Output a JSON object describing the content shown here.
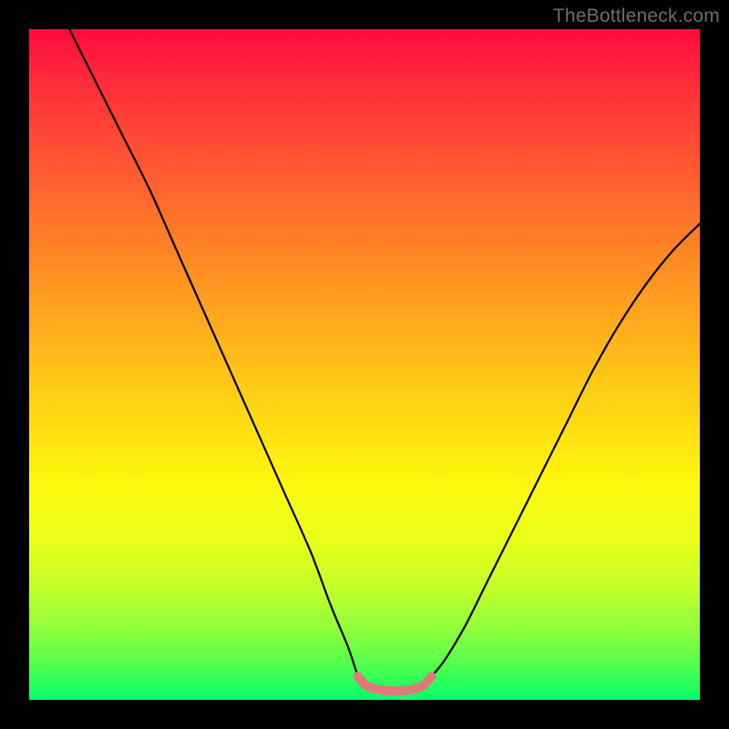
{
  "watermark": "TheBottleneck.com",
  "chart_data": {
    "type": "line",
    "title": "",
    "xlabel": "",
    "ylabel": "",
    "xlim": [
      0,
      100
    ],
    "ylim": [
      0,
      100
    ],
    "grid": false,
    "legend": false,
    "background_gradient": {
      "orientation": "vertical",
      "stops": [
        {
          "pos": 0,
          "color": "#ff0a3c"
        },
        {
          "pos": 18,
          "color": "#ff4f33"
        },
        {
          "pos": 42,
          "color": "#ffa41e"
        },
        {
          "pos": 67,
          "color": "#fff60d"
        },
        {
          "pos": 89,
          "color": "#94ff3a"
        },
        {
          "pos": 100,
          "color": "#08ff72"
        }
      ]
    },
    "series": [
      {
        "name": "left-curve",
        "stroke": "#000000",
        "x": [
          6,
          10,
          14,
          18,
          22,
          26,
          30,
          34,
          38,
          42,
          45,
          47.5,
          49
        ],
        "y": [
          100,
          92,
          84,
          76,
          67,
          58,
          49,
          40,
          31,
          22,
          14,
          8,
          3.5
        ]
      },
      {
        "name": "right-curve",
        "stroke": "#000000",
        "x": [
          60,
          62,
          65,
          68,
          72,
          76,
          80,
          84,
          88,
          92,
          96,
          100
        ],
        "y": [
          3.5,
          6,
          11,
          17,
          25,
          33,
          41,
          49,
          56,
          62,
          67,
          71
        ]
      },
      {
        "name": "valley-band",
        "stroke": "#e07a7a",
        "stroke_width": 10,
        "x": [
          49,
          50.5,
          53,
          56,
          58.5,
          60
        ],
        "y": [
          3.5,
          2.0,
          1.4,
          1.4,
          2.0,
          3.5
        ]
      }
    ]
  }
}
